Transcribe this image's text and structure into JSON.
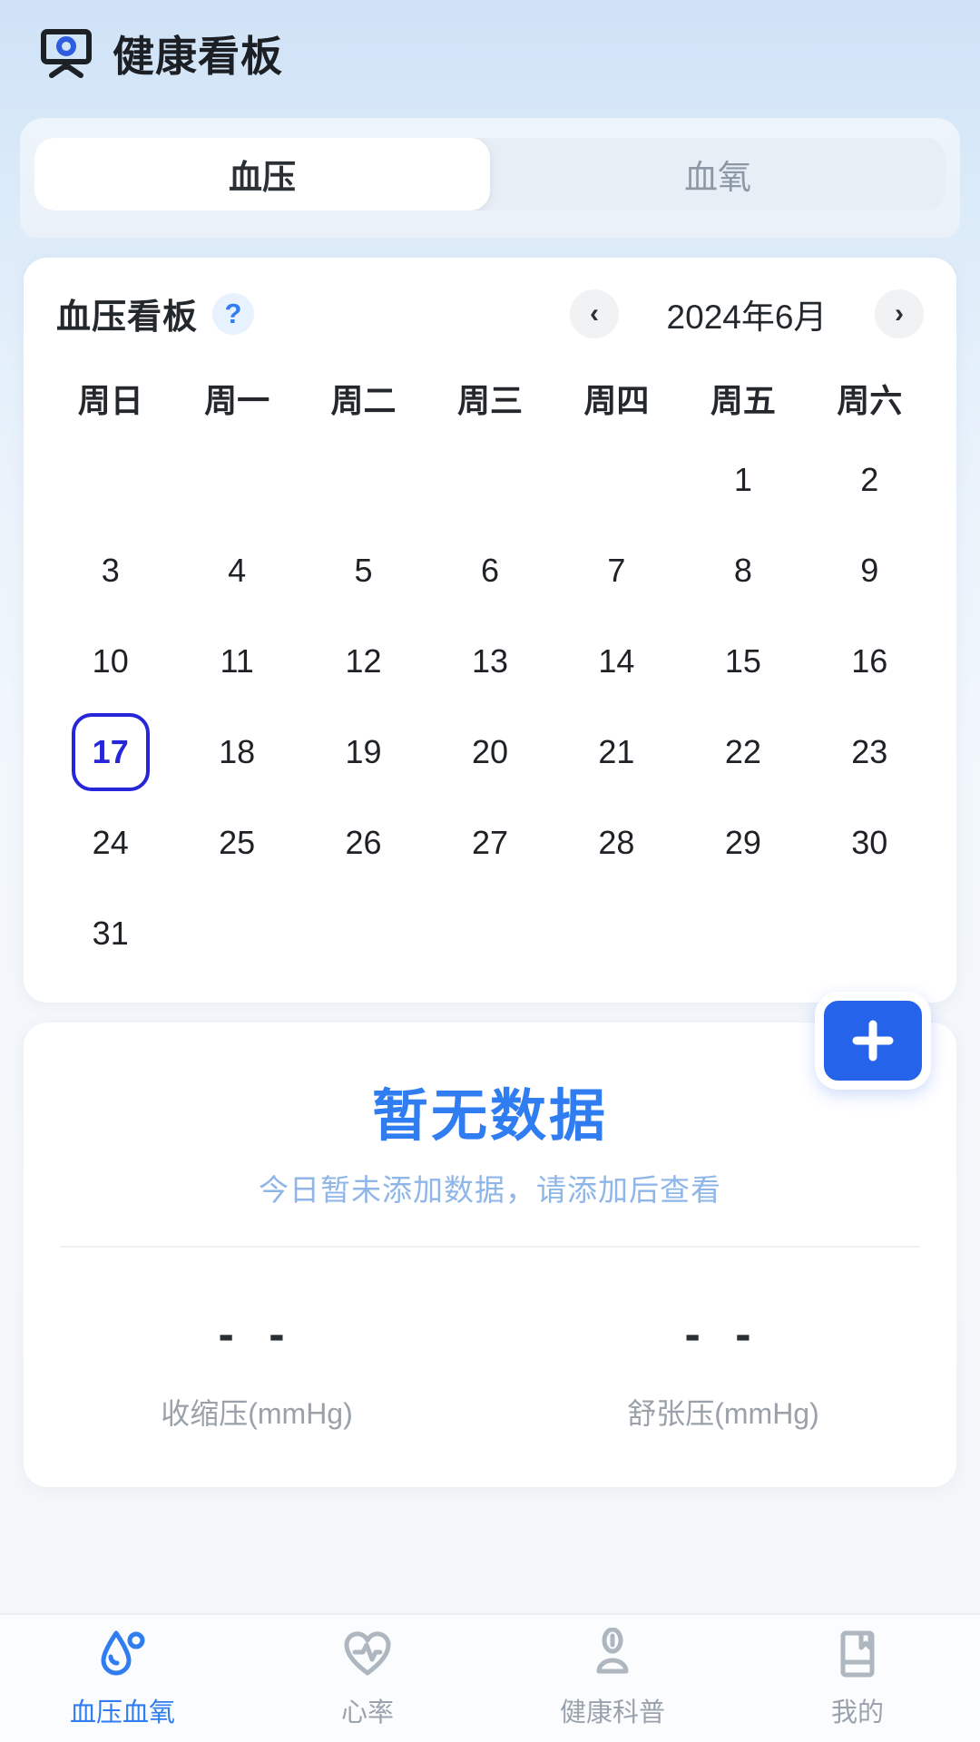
{
  "header": {
    "title": "健康看板",
    "icon": "board-monitor-icon"
  },
  "tabs": [
    {
      "label": "血压",
      "active": true
    },
    {
      "label": "血氧",
      "active": false
    }
  ],
  "calendar": {
    "title": "血压看板",
    "help_icon": "?",
    "month_label": "2024年6月",
    "prev_icon": "‹",
    "next_icon": "›",
    "weekdays": [
      "周日",
      "周一",
      "周二",
      "周三",
      "周四",
      "周五",
      "周六"
    ],
    "weeks": [
      [
        "",
        "",
        "",
        "",
        "",
        "1",
        "2"
      ],
      [
        "3",
        "4",
        "5",
        "6",
        "7",
        "8",
        "9"
      ],
      [
        "10",
        "11",
        "12",
        "13",
        "14",
        "15",
        "16"
      ],
      [
        "17",
        "18",
        "19",
        "20",
        "21",
        "22",
        "23"
      ],
      [
        "24",
        "25",
        "26",
        "27",
        "28",
        "29",
        "30"
      ],
      [
        "31",
        "",
        "",
        "",
        "",
        "",
        ""
      ]
    ],
    "selected_day": "17",
    "selected_color": "#2626d8"
  },
  "data_panel": {
    "empty_title": "暂无数据",
    "empty_subtitle": "今日暂未添加数据，请添加后查看",
    "add_button_icon": "plus-icon",
    "accent_color": "#2563eb",
    "metrics": [
      {
        "value": "- -",
        "label": "收缩压(mmHg)"
      },
      {
        "value": "- -",
        "label": "舒张压(mmHg)"
      }
    ]
  },
  "bottom_nav": [
    {
      "label": "血压血氧",
      "icon": "blood-drop-icon",
      "active": true
    },
    {
      "label": "心率",
      "icon": "heart-pulse-icon",
      "active": false
    },
    {
      "label": "健康科普",
      "icon": "person-info-icon",
      "active": false
    },
    {
      "label": "我的",
      "icon": "book-bookmark-icon",
      "active": false
    }
  ]
}
